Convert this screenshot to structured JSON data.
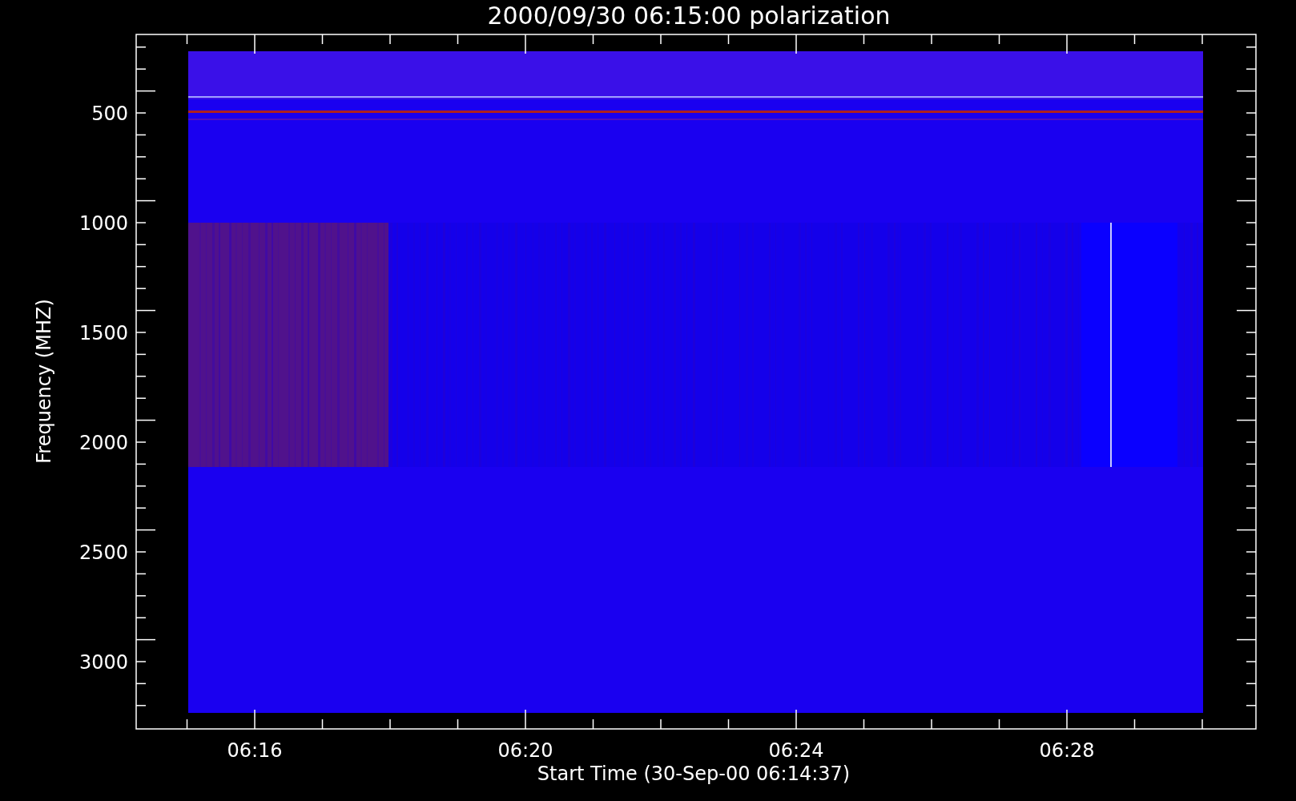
{
  "plot": {
    "title": "2000/09/30 06:15:00 polarization",
    "ylabel": "Frequency (MHZ)",
    "xlabel": "Start Time (30-Sep-00 06:14:37)",
    "yticks": [
      "500",
      "1000",
      "1500",
      "2000",
      "2500",
      "3000"
    ],
    "xticks": [
      "06:16",
      "06:20",
      "06:24",
      "06:28"
    ]
  }
}
